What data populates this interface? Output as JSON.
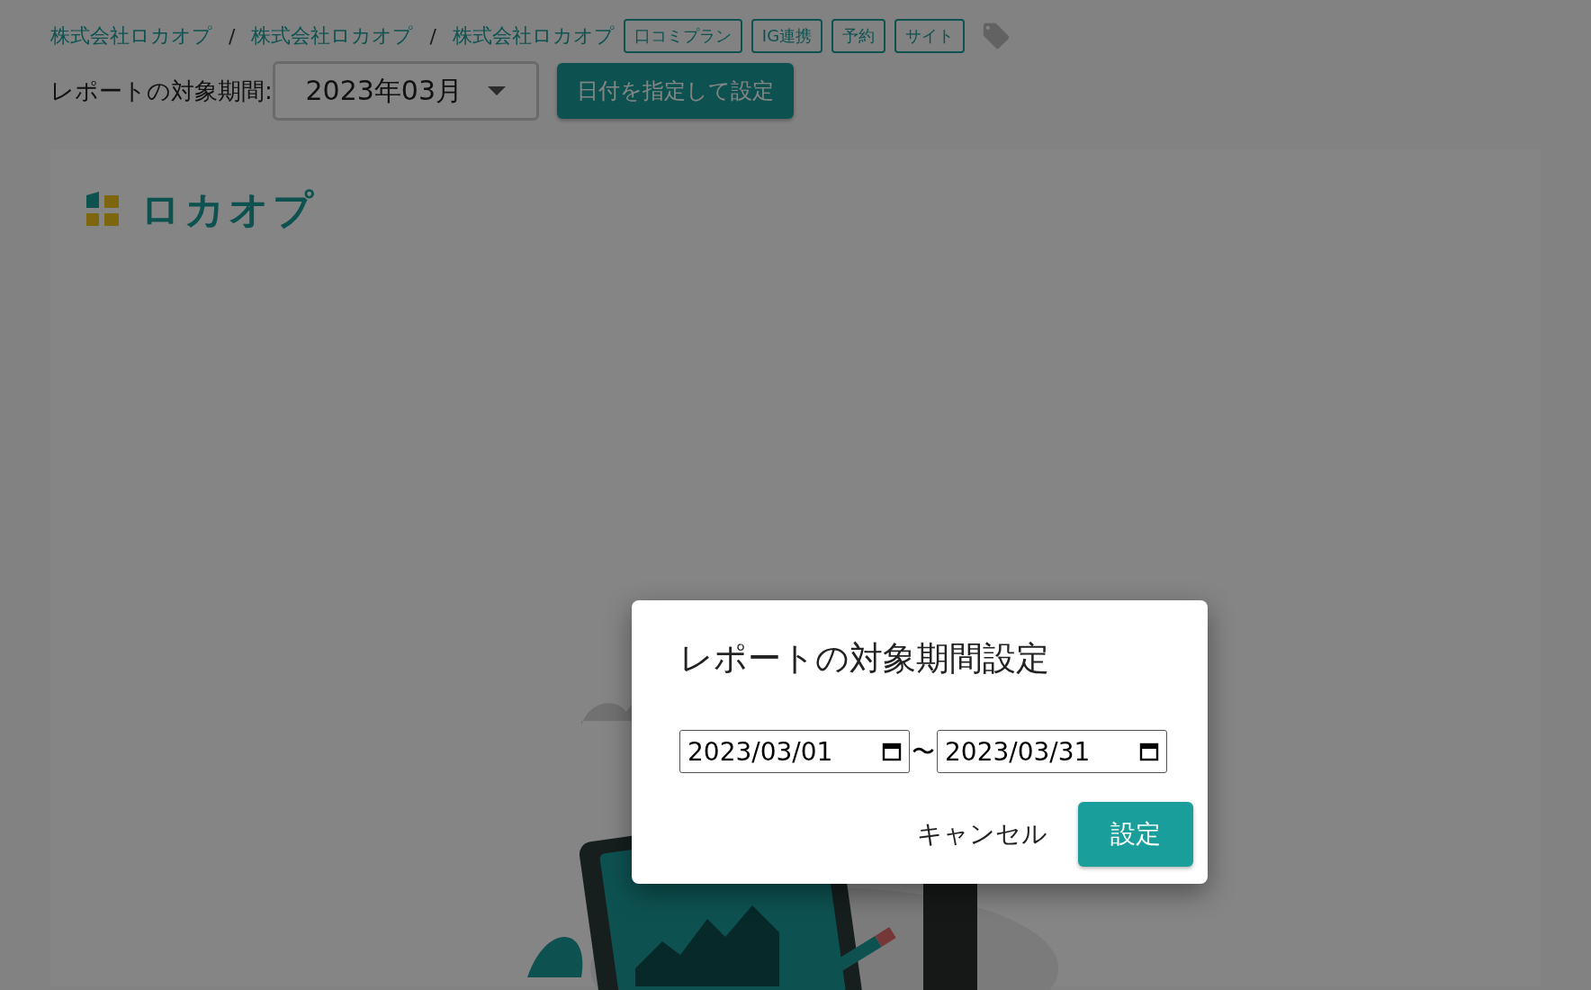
{
  "breadcrumbs": [
    "株式会社ロカオプ",
    "株式会社ロカオプ",
    "株式会社ロカオプ"
  ],
  "breadcrumb_separator": "/",
  "tags": [
    "口コミプラン",
    "IG連携",
    "予約",
    "サイト"
  ],
  "period": {
    "label": "レポートの対象期間:",
    "value": "2023年03月"
  },
  "custom_date_button": "日付を指定して設定",
  "logo": "ロカオプ",
  "dialog": {
    "title": "レポートの対象期間設定",
    "start_date": "2023/03/01",
    "separator": "〜",
    "end_date": "2023/03/31",
    "cancel": "キャンセル",
    "confirm": "設定"
  }
}
